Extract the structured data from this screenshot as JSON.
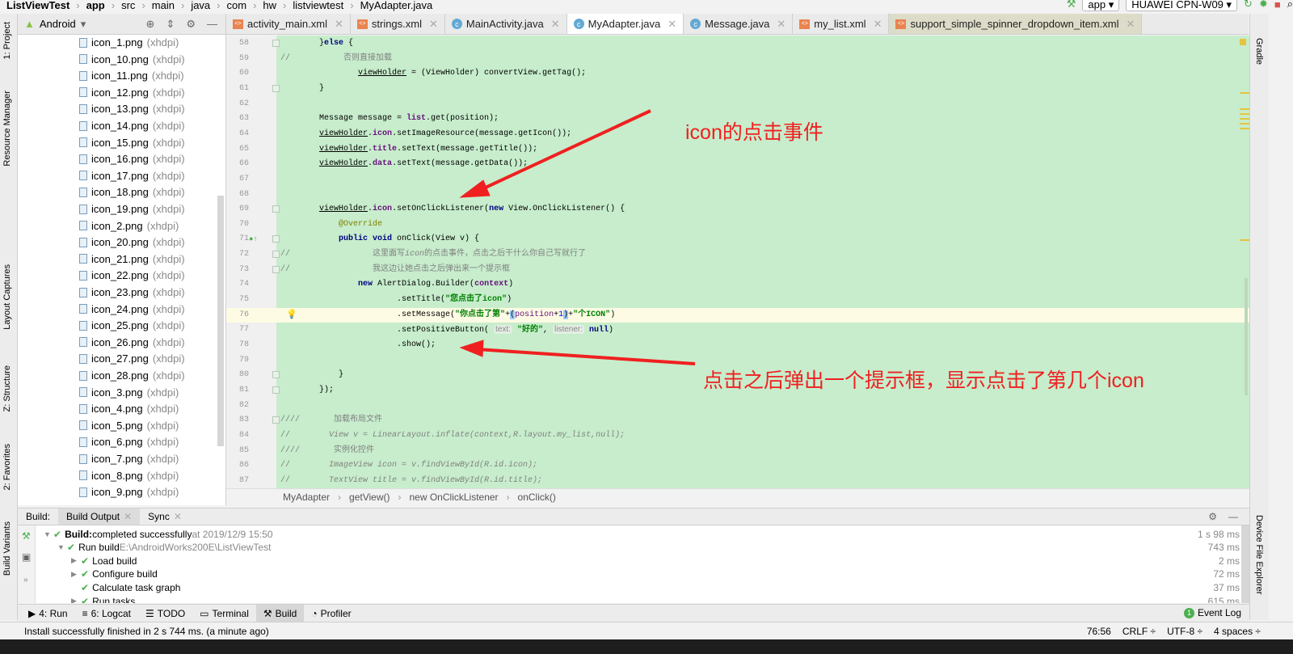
{
  "navbar": {
    "crumbs": [
      "ListViewTest",
      "app",
      "src",
      "main",
      "java",
      "com",
      "hw",
      "listviewtest",
      "MyAdapter.java"
    ],
    "run_config": "app",
    "device": "HUAWEI CPN-W09"
  },
  "tabs": [
    {
      "label": "activity_main.xml",
      "icon": "xml-file-icon",
      "active": false
    },
    {
      "label": "strings.xml",
      "icon": "xml-file-icon",
      "active": false
    },
    {
      "label": "MainActivity.java",
      "icon": "java-class-icon",
      "active": false
    },
    {
      "label": "MyAdapter.java",
      "icon": "java-class-icon",
      "active": true
    },
    {
      "label": "Message.java",
      "icon": "java-class-icon",
      "active": false
    },
    {
      "label": "my_list.xml",
      "icon": "xml-file-icon",
      "active": false
    },
    {
      "label": "support_simple_spinner_dropdown_item.xml",
      "icon": "xml-file-icon",
      "active": false
    }
  ],
  "left_strip": {
    "project": "1: Project",
    "resource_manager": "Resource Manager",
    "layout_captures": "Layout Captures",
    "structure": "Z: Structure",
    "favorites": "2: Favorites",
    "build_variants": "Build Variants"
  },
  "right_strip": {
    "gradle": "Gradle",
    "device_file_explorer": "Device File Explorer"
  },
  "project": {
    "view": "Android",
    "qualifier": "(xhdpi)",
    "files": [
      "icon_1.png",
      "icon_10.png",
      "icon_11.png",
      "icon_12.png",
      "icon_13.png",
      "icon_14.png",
      "icon_15.png",
      "icon_16.png",
      "icon_17.png",
      "icon_18.png",
      "icon_19.png",
      "icon_2.png",
      "icon_20.png",
      "icon_21.png",
      "icon_22.png",
      "icon_23.png",
      "icon_24.png",
      "icon_25.png",
      "icon_26.png",
      "icon_27.png",
      "icon_28.png",
      "icon_3.png",
      "icon_4.png",
      "icon_5.png",
      "icon_6.png",
      "icon_7.png",
      "icon_8.png",
      "icon_9.png"
    ]
  },
  "editor": {
    "current_line": 76,
    "lines": [
      {
        "n": 58,
        "fold": true,
        "t": [
          [
            "        }",
            ""
          ],
          [
            "else",
            "kw"
          ],
          [
            " {",
            ""
          ]
        ]
      },
      {
        "n": 59,
        "t": [
          [
            "//           ",
            "cm"
          ],
          [
            "否则直接加载",
            "cm"
          ]
        ]
      },
      {
        "n": 60,
        "t": [
          [
            "                ",
            ""
          ],
          [
            "viewHolder",
            "u"
          ],
          [
            " = (ViewHolder) convertView.getTag();",
            ""
          ]
        ]
      },
      {
        "n": 61,
        "fold": true,
        "t": [
          [
            "        }",
            ""
          ]
        ]
      },
      {
        "n": 62,
        "t": []
      },
      {
        "n": 63,
        "t": [
          [
            "        Message message = ",
            ""
          ],
          [
            "list",
            "fld"
          ],
          [
            ".get(position);",
            ""
          ]
        ]
      },
      {
        "n": 64,
        "t": [
          [
            "        ",
            ""
          ],
          [
            "viewHolder",
            "u"
          ],
          [
            ".",
            ""
          ],
          [
            "icon",
            "fld"
          ],
          [
            ".setImageResource(message.getIcon());",
            ""
          ]
        ]
      },
      {
        "n": 65,
        "t": [
          [
            "        ",
            ""
          ],
          [
            "viewHolder",
            "u"
          ],
          [
            ".",
            ""
          ],
          [
            "title",
            "fld"
          ],
          [
            ".setText(message.getTitle());",
            ""
          ]
        ]
      },
      {
        "n": 66,
        "t": [
          [
            "        ",
            ""
          ],
          [
            "viewHolder",
            "u"
          ],
          [
            ".",
            ""
          ],
          [
            "data",
            "fld"
          ],
          [
            ".setText(message.getData());",
            ""
          ]
        ]
      },
      {
        "n": 67,
        "t": []
      },
      {
        "n": 68,
        "t": []
      },
      {
        "n": 69,
        "fold": true,
        "t": [
          [
            "        ",
            ""
          ],
          [
            "viewHolder",
            "u"
          ],
          [
            ".",
            ""
          ],
          [
            "icon",
            "fld"
          ],
          [
            ".setOnClickListener(",
            ""
          ],
          [
            "new",
            "kw"
          ],
          [
            " View.OnClickListener() {",
            ""
          ]
        ]
      },
      {
        "n": 70,
        "t": [
          [
            "            ",
            ""
          ],
          [
            "@Override",
            "ann"
          ]
        ]
      },
      {
        "n": 71,
        "fold": true,
        "t": [
          [
            "            ",
            ""
          ],
          [
            "public void",
            "kw"
          ],
          [
            " onClick(View v) {",
            ""
          ]
        ]
      },
      {
        "n": 72,
        "fold": true,
        "t": [
          [
            "//                 ",
            "cm"
          ],
          [
            "这里面写",
            "cm"
          ],
          [
            "icon",
            "cmi"
          ],
          [
            "的点击事件，点击之后干什么你自己写就行了",
            "cm"
          ]
        ]
      },
      {
        "n": 73,
        "fold": true,
        "t": [
          [
            "//                 ",
            "cm"
          ],
          [
            "我这边让她点击之后弹出来一个提示框",
            "cm"
          ]
        ]
      },
      {
        "n": 74,
        "t": [
          [
            "                ",
            ""
          ],
          [
            "new",
            "kw"
          ],
          [
            " AlertDialog.Builder(",
            ""
          ],
          [
            "context",
            "fld"
          ],
          [
            ")",
            ""
          ]
        ]
      },
      {
        "n": 75,
        "t": [
          [
            "                        .setTitle(",
            ""
          ],
          [
            "\"您点击了icon\"",
            "str"
          ],
          [
            ")",
            ""
          ]
        ]
      },
      {
        "n": 76,
        "t": [
          [
            "                        .setMessage(",
            ""
          ],
          [
            "\"你点击了第\"",
            "str"
          ],
          [
            "+",
            ""
          ],
          [
            "(",
            "brk"
          ],
          [
            "position",
            "pos"
          ],
          [
            "+",
            ""
          ],
          [
            "1",
            "num"
          ],
          [
            ")",
            "brk"
          ],
          [
            "+",
            ""
          ],
          [
            "\"个ICON\"",
            "str"
          ],
          [
            ")",
            ""
          ]
        ]
      },
      {
        "n": 77,
        "t": [
          [
            "                        .setPositiveButton( ",
            ""
          ],
          [
            "text:",
            "hint"
          ],
          [
            " ",
            ""
          ],
          [
            "\"好的\"",
            "str"
          ],
          [
            ", ",
            ""
          ],
          [
            "listener:",
            "hint"
          ],
          [
            " ",
            ""
          ],
          [
            "null",
            "kw"
          ],
          [
            ")",
            ""
          ]
        ]
      },
      {
        "n": 78,
        "t": [
          [
            "                        .show();",
            ""
          ]
        ]
      },
      {
        "n": 79,
        "t": []
      },
      {
        "n": 80,
        "fold": true,
        "t": [
          [
            "            }",
            ""
          ]
        ]
      },
      {
        "n": 81,
        "fold": true,
        "t": [
          [
            "        });",
            ""
          ]
        ]
      },
      {
        "n": 82,
        "t": []
      },
      {
        "n": 83,
        "fold": true,
        "t": [
          [
            "////       ",
            "cm"
          ],
          [
            "加载布局文件",
            "cm"
          ]
        ]
      },
      {
        "n": 84,
        "t": [
          [
            "//        ",
            "cm"
          ],
          [
            "View v = LinearLayout.inflate(context,R.layout.my_list,null);",
            "cmi"
          ]
        ]
      },
      {
        "n": 85,
        "t": [
          [
            "////       ",
            "cm"
          ],
          [
            "实例化控件",
            "cm"
          ]
        ]
      },
      {
        "n": 86,
        "t": [
          [
            "//        ",
            "cm"
          ],
          [
            "ImageView icon = v.findViewById(R.id.icon);",
            "cmi"
          ]
        ]
      },
      {
        "n": 87,
        "t": [
          [
            "//        ",
            "cm"
          ],
          [
            "TextView title = v.findViewById(R.id.title);",
            "cmi"
          ]
        ]
      }
    ]
  },
  "annotations": {
    "note1": "icon的点击事件",
    "note2": "点击之后弹出一个提示框，显示点击了第几个icon",
    "color": "#f02020"
  },
  "breadcrumb": [
    "MyAdapter",
    "getView()",
    "new OnClickListener",
    "onClick()"
  ],
  "build": {
    "label": "Build:",
    "tabs": [
      "Build Output",
      "Sync"
    ],
    "rows": [
      {
        "bold": "Build:",
        "text": " completed successfully",
        "extra": " at 2019/12/9 15:50",
        "dur": "1 s 98 ms",
        "level": 0,
        "arrow": "▼"
      },
      {
        "text": "Run build",
        "extra": " E:\\AndroidWorks200E\\ListViewTest",
        "dur": "743 ms",
        "level": 1,
        "arrow": "▼"
      },
      {
        "text": "Load build",
        "dur": "2 ms",
        "level": 2,
        "arrow": "▶"
      },
      {
        "text": "Configure build",
        "dur": "72 ms",
        "level": 2,
        "arrow": "▶"
      },
      {
        "text": "Calculate task graph",
        "dur": "37 ms",
        "level": 2,
        "arrow": ""
      },
      {
        "text": "Run tasks",
        "dur": "615 ms",
        "level": 2,
        "arrow": "▶"
      }
    ]
  },
  "bottom_tools": [
    "4: Run",
    "6: Logcat",
    "TODO",
    "Terminal",
    "Build",
    "Profiler"
  ],
  "event_log": {
    "count": "1",
    "label": "Event Log"
  },
  "status": {
    "message": "Install successfully finished in 2 s 744 ms. (a minute ago)",
    "position": "76:56",
    "line_sep": "CRLF ÷",
    "encoding": "UTF-8 ÷",
    "indent": "4 spaces ÷"
  }
}
